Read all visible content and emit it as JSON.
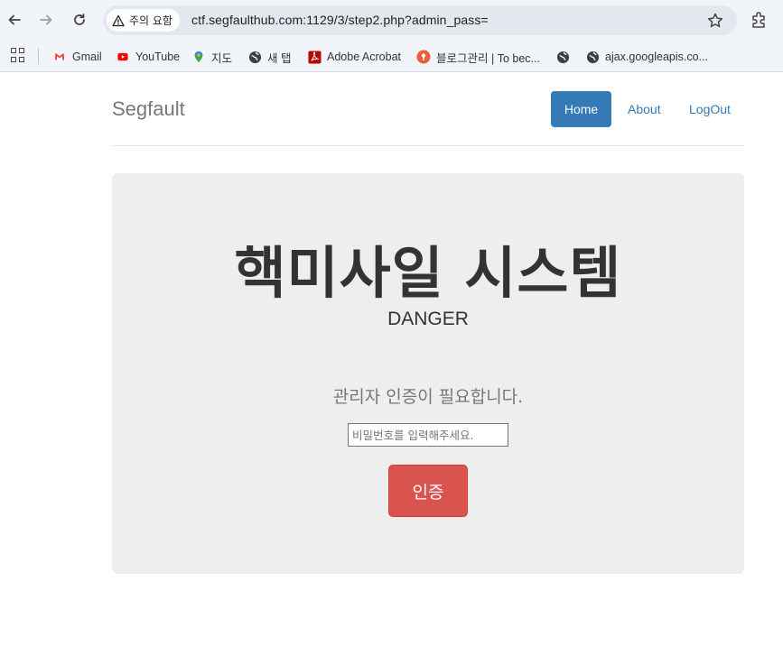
{
  "browser": {
    "security_label": "주의 요함",
    "url": "ctf.segfaulthub.com:1129/3/step2.php?admin_pass=",
    "bookmarks": [
      {
        "label": "Gmail",
        "icon": "gmail-icon"
      },
      {
        "label": "YouTube",
        "icon": "youtube-icon"
      },
      {
        "label": "지도",
        "icon": "maps-icon"
      },
      {
        "label": "새 탭",
        "icon": "globe-icon"
      },
      {
        "label": "Adobe Acrobat",
        "icon": "acrobat-icon"
      },
      {
        "label": "블로그관리 | To bec...",
        "icon": "blog-icon"
      },
      {
        "label": "",
        "icon": "globe-icon"
      },
      {
        "label": "ajax.googleapis.co...",
        "icon": "globe-icon"
      }
    ]
  },
  "site": {
    "brand": "Segfault",
    "nav": {
      "home": "Home",
      "about": "About",
      "logout": "LogOut"
    }
  },
  "main": {
    "title": "핵미사일 시스템",
    "subtitle": "DANGER",
    "lead": "관리자 인증이 필요합니다.",
    "password_placeholder": "비밀번호를 입력해주세요.",
    "password_value": "",
    "submit_label": "인증"
  },
  "colors": {
    "primary": "#337ab7",
    "danger": "#d9534f",
    "jumbotron_bg": "#eeeeee"
  }
}
